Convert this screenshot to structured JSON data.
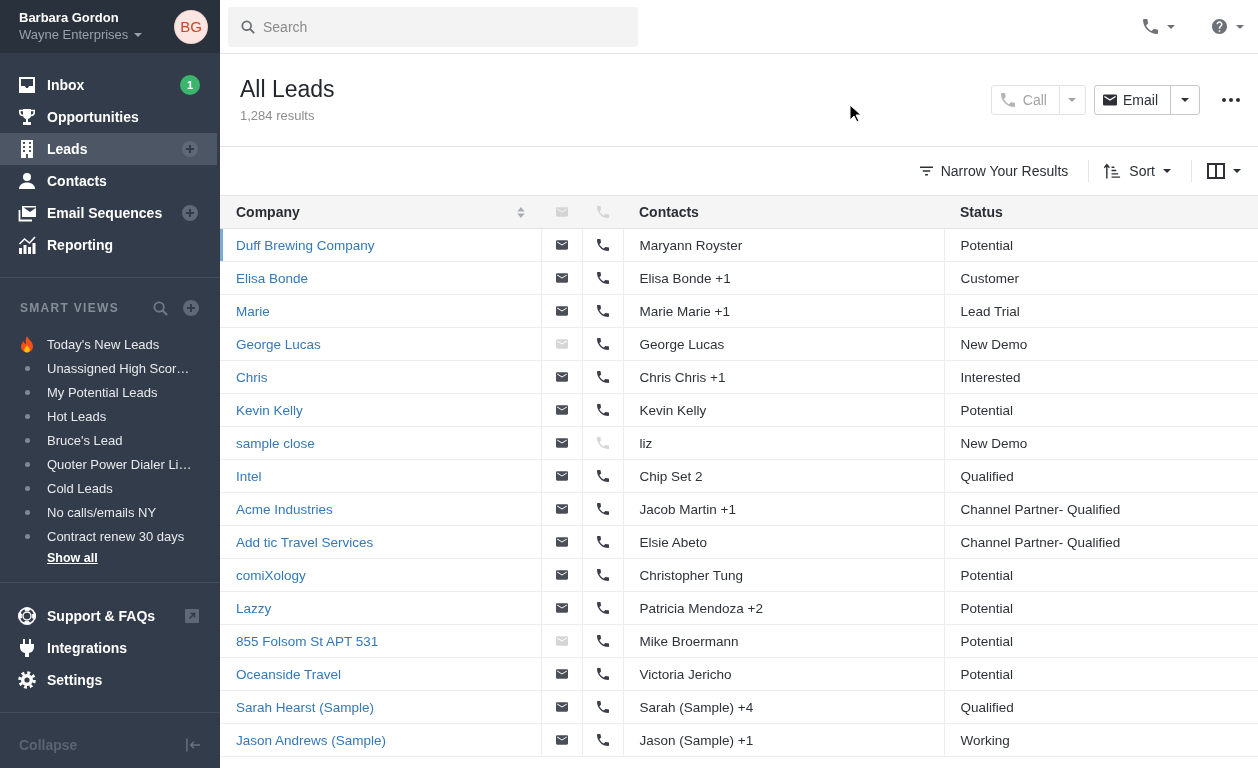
{
  "sidebar": {
    "account": {
      "name": "Barbara Gordon",
      "organization": "Wayne Enterprises",
      "avatar_initials": "BG"
    },
    "nav": [
      {
        "label": "Inbox",
        "selected": false,
        "badge": "1",
        "add": false
      },
      {
        "label": "Opportunities",
        "selected": false,
        "add": false
      },
      {
        "label": "Leads",
        "selected": true,
        "add": true
      },
      {
        "label": "Contacts",
        "selected": false,
        "add": false
      },
      {
        "label": "Email Sequences",
        "selected": false,
        "add": true
      },
      {
        "label": "Reporting",
        "selected": false,
        "add": false
      }
    ],
    "smart_views": {
      "title": "SMART VIEWS",
      "items": [
        {
          "kind": "hot",
          "label": "Today's New Leads"
        },
        {
          "kind": "plain",
          "label": "Unassigned High Scor…"
        },
        {
          "kind": "plain",
          "label": "My Potential Leads"
        },
        {
          "kind": "plain",
          "label": "Hot Leads"
        },
        {
          "kind": "plain",
          "label": "Bruce's Lead"
        },
        {
          "kind": "plain",
          "label": "Quoter Power Dialer Li…"
        },
        {
          "kind": "plain",
          "label": "Cold Leads"
        },
        {
          "kind": "plain",
          "label": "No calls/emails NY"
        },
        {
          "kind": "plain",
          "label": "Contract renew 30 days"
        }
      ],
      "show_all": "Show all"
    },
    "footer_nav": [
      {
        "label": "Support & FAQs",
        "external": true
      },
      {
        "label": "Integrations",
        "external": false
      },
      {
        "label": "Settings",
        "external": false
      }
    ],
    "collapse": "Collapse"
  },
  "topbar": {
    "search": {
      "placeholder": "Search"
    }
  },
  "header": {
    "title": "All Leads",
    "count": "1,284 results",
    "actions": [
      {
        "kind": "call",
        "label": "Call",
        "disabled": true
      },
      {
        "kind": "email",
        "label": "Email",
        "disabled": false
      }
    ]
  },
  "toolbar": {
    "filter": "Narrow Your Results",
    "sort": "Sort"
  },
  "table": {
    "columns": [
      {
        "kind": "text",
        "label": "Company",
        "sortable": true
      },
      {
        "kind": "email"
      },
      {
        "kind": "phone"
      },
      {
        "kind": "text",
        "label": "Contacts",
        "sortable": false
      },
      {
        "kind": "text",
        "label": "Status",
        "sortable": false
      }
    ],
    "rows": [
      {
        "company": "Duff Brewing Company",
        "has_email": true,
        "has_phone": true,
        "contacts": "Maryann Royster",
        "status": "Potential",
        "selected": true
      },
      {
        "company": "Elisa Bonde",
        "has_email": true,
        "has_phone": true,
        "contacts": "Elisa Bonde +1",
        "status": "Customer",
        "selected": false
      },
      {
        "company": "Marie",
        "has_email": true,
        "has_phone": true,
        "contacts": "Marie Marie +1",
        "status": "Lead Trial",
        "selected": false
      },
      {
        "company": "George Lucas",
        "has_email": false,
        "has_phone": true,
        "contacts": "George Lucas",
        "status": "New Demo",
        "selected": false
      },
      {
        "company": "Chris",
        "has_email": true,
        "has_phone": true,
        "contacts": "Chris Chris +1",
        "status": "Interested",
        "selected": false
      },
      {
        "company": "Kevin Kelly",
        "has_email": true,
        "has_phone": true,
        "contacts": "Kevin Kelly",
        "status": "Potential",
        "selected": false
      },
      {
        "company": "sample close",
        "has_email": true,
        "has_phone": false,
        "contacts": "liz",
        "status": "New Demo",
        "selected": false
      },
      {
        "company": "Intel",
        "has_email": true,
        "has_phone": true,
        "contacts": "Chip Set 2",
        "status": "Qualified",
        "selected": false
      },
      {
        "company": "Acme Industries",
        "has_email": true,
        "has_phone": true,
        "contacts": "Jacob Martin +1",
        "status": "Channel Partner- Qualified",
        "selected": false
      },
      {
        "company": "Add tic Travel Services",
        "has_email": true,
        "has_phone": true,
        "contacts": "Elsie Abeto",
        "status": "Channel Partner- Qualified",
        "selected": false
      },
      {
        "company": "comiXology",
        "has_email": true,
        "has_phone": true,
        "contacts": "Christopher Tung",
        "status": "Potential",
        "selected": false
      },
      {
        "company": "Lazzy",
        "has_email": true,
        "has_phone": true,
        "contacts": "Patricia Mendoza +2",
        "status": "Potential",
        "selected": false
      },
      {
        "company": "855 Folsom St APT 531",
        "has_email": false,
        "has_phone": true,
        "contacts": "Mike Broermann",
        "status": "Potential",
        "selected": false
      },
      {
        "company": "Oceanside Travel",
        "has_email": true,
        "has_phone": true,
        "contacts": "Victoria Jericho",
        "status": "Potential",
        "selected": false
      },
      {
        "company": "Sarah Hearst (Sample)",
        "has_email": true,
        "has_phone": true,
        "contacts": "Sarah (Sample) +4",
        "status": "Qualified",
        "selected": false
      },
      {
        "company": "Jason Andrews (Sample)",
        "has_email": true,
        "has_phone": true,
        "contacts": "Jason (Sample) +1",
        "status": "Working",
        "selected": false
      }
    ]
  }
}
